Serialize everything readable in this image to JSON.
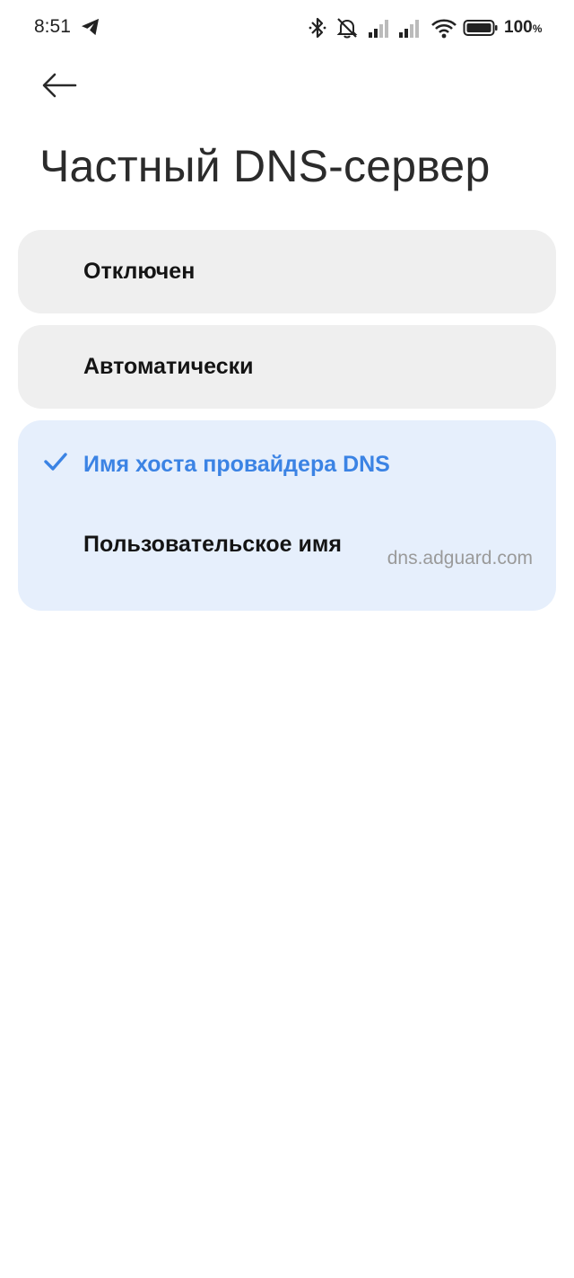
{
  "status_bar": {
    "time": "8:51",
    "battery": "100",
    "battery_suffix": "%",
    "icons": [
      "telegram-icon",
      "bluetooth-icon",
      "mute-icon",
      "signal-icon",
      "signal-icon",
      "wifi-icon",
      "battery-icon"
    ]
  },
  "header": {
    "back_icon": "arrow-left-icon",
    "title": "Частный DNS-сервер"
  },
  "options": {
    "off_label": "Отключен",
    "auto_label": "Автоматически",
    "host_label": "Имя хоста провайдера DNS",
    "custom_label": "Пользовательское имя",
    "custom_value": "dns.adguard.com",
    "selected": "host"
  },
  "colors": {
    "accent": "#3b83e4",
    "card_bg": "#efefef",
    "selected_card_bg": "#e6effc"
  }
}
